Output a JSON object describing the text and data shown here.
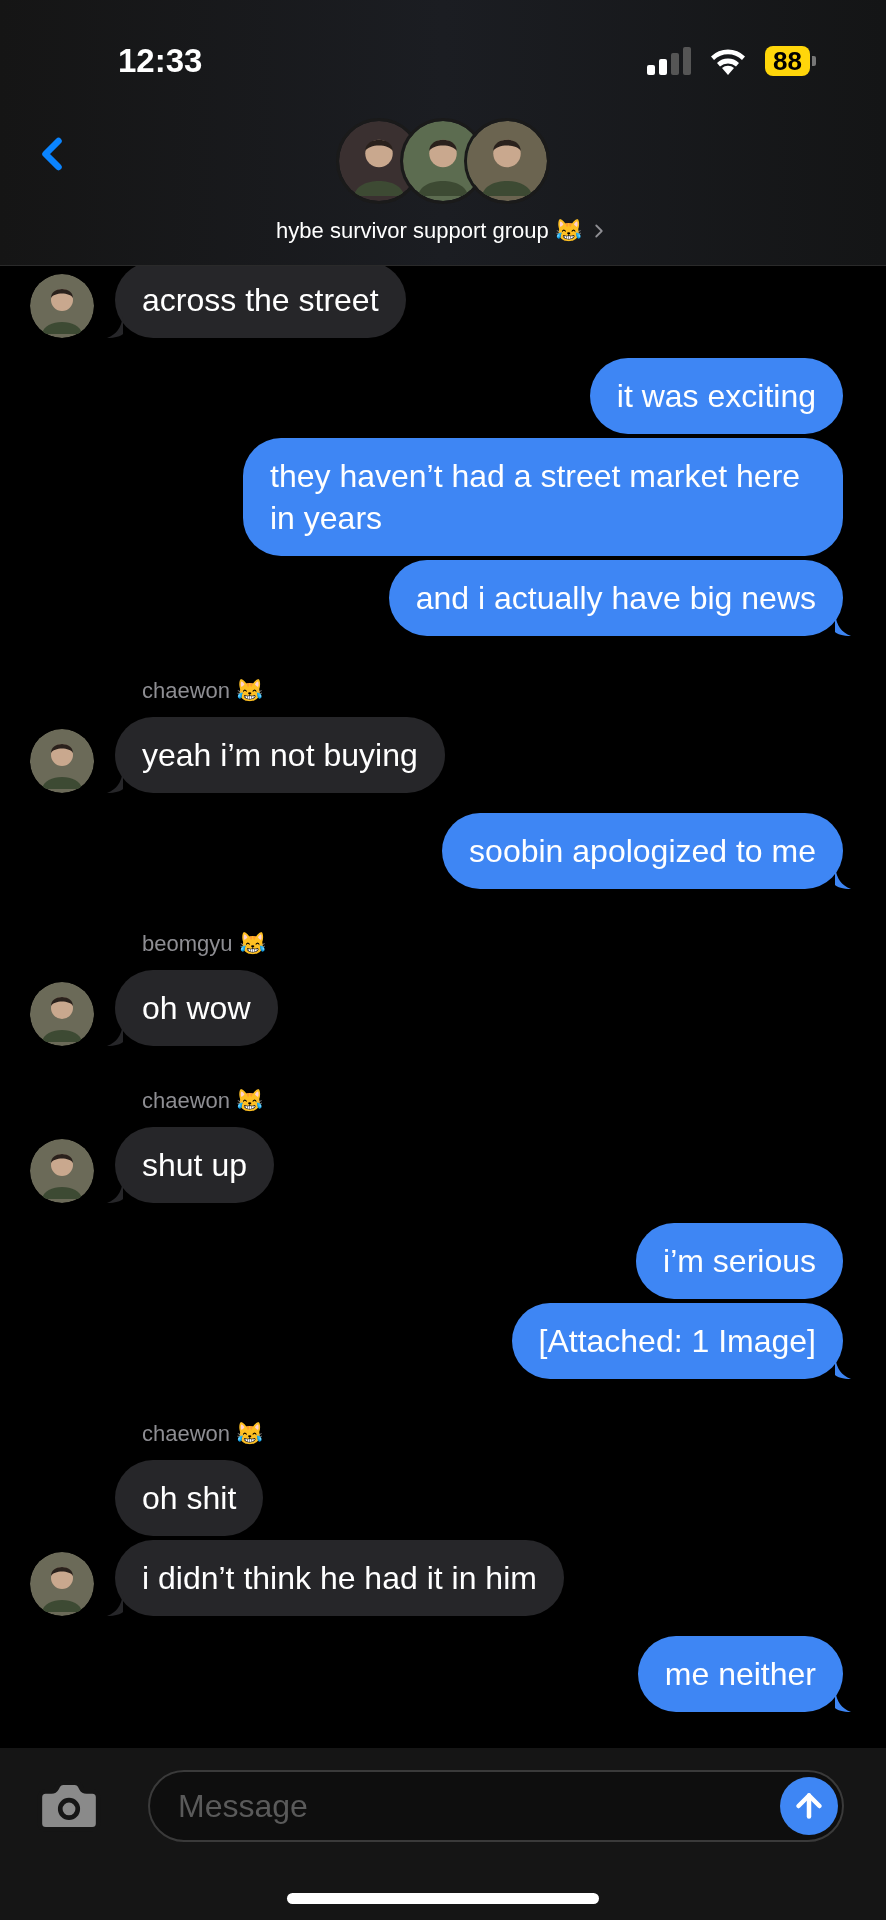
{
  "status_bar": {
    "time": "12:33",
    "battery": "88"
  },
  "header": {
    "title": "hybe survivor support group 😹"
  },
  "messages": [
    {
      "kind": "in",
      "text": "across the street",
      "tail": true
    },
    {
      "kind": "out",
      "text": "it was exciting",
      "tail": false
    },
    {
      "kind": "out",
      "text": "they haven’t had a street market here in years",
      "tail": false
    },
    {
      "kind": "out",
      "text": "and i actually have big news",
      "tail": true
    },
    {
      "kind": "sender",
      "text": "chaewon 😹"
    },
    {
      "kind": "in",
      "text": "yeah i’m not buying",
      "tail": true
    },
    {
      "kind": "out",
      "text": "soobin apologized to me",
      "tail": true
    },
    {
      "kind": "sender",
      "text": "beomgyu 😹"
    },
    {
      "kind": "in",
      "text": "oh wow",
      "tail": true
    },
    {
      "kind": "sender",
      "text": "chaewon 😹"
    },
    {
      "kind": "in",
      "text": "shut up",
      "tail": true
    },
    {
      "kind": "out",
      "text": "i’m serious",
      "tail": false
    },
    {
      "kind": "out",
      "text": "[Attached: 1 Image]",
      "tail": true
    },
    {
      "kind": "sender",
      "text": "chaewon 😹"
    },
    {
      "kind": "in",
      "text": "oh shit",
      "tail": false
    },
    {
      "kind": "in",
      "text": "i didn’t think he had it in him",
      "tail": true
    },
    {
      "kind": "out",
      "text": "me neither",
      "tail": true
    }
  ],
  "composer": {
    "placeholder": "Message"
  }
}
